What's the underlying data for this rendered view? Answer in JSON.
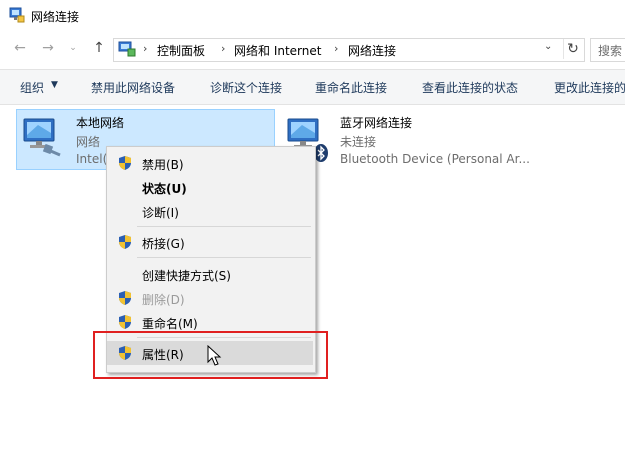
{
  "window": {
    "title": "网络连接"
  },
  "address": {
    "crumbs": [
      "控制面板",
      "网络和 Internet",
      "网络连接"
    ],
    "search_placeholder": "搜索"
  },
  "commands": {
    "organize": "组织",
    "disable_device": "禁用此网络设备",
    "diagnose": "诊断这个连接",
    "rename": "重命名此连接",
    "view_status": "查看此连接的状态",
    "change_settings": "更改此连接的"
  },
  "items": [
    {
      "name": "本地网络",
      "status": "网络",
      "device": "Intel(",
      "selected": true
    },
    {
      "name": "蓝牙网络连接",
      "status": "未连接",
      "device": "Bluetooth Device (Personal Ar..."
    }
  ],
  "context_menu": {
    "disable": "禁用(B)",
    "status": "状态(U)",
    "diagnose": "诊断(I)",
    "bridge": "桥接(G)",
    "shortcut": "创建快捷方式(S)",
    "delete": "删除(D)",
    "rename": "重命名(M)",
    "properties": "属性(R)"
  },
  "colors": {
    "selection_bg": "#cce8ff",
    "highlight_box": "#e02020",
    "command_text": "#1e395b"
  }
}
